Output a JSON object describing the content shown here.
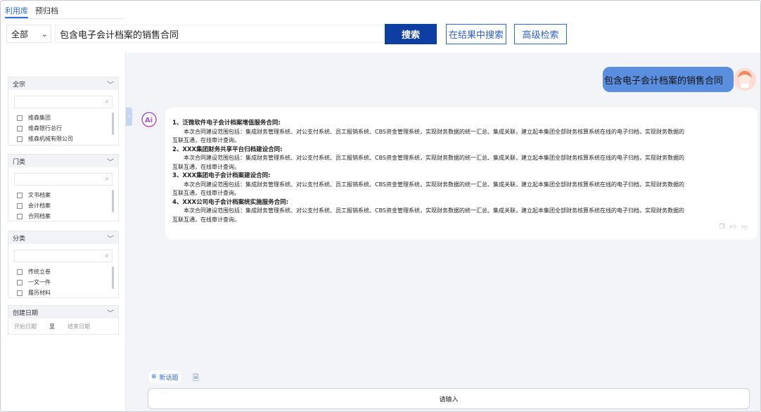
{
  "top_tabs": [
    {
      "label": "利用库",
      "active": true
    },
    {
      "label": "预归档",
      "active": false
    }
  ],
  "search": {
    "scope": "全部",
    "query": "包含电子会计档案的销售合同",
    "search_label": "搜索",
    "in_results_label": "在结果中搜索",
    "advanced_label": "高级检索"
  },
  "filters": {
    "fonds": {
      "title": "全宗",
      "items": [
        "维森集团",
        "维森银行总行",
        "维森机械有限公司"
      ]
    },
    "category_door": {
      "title": "门类",
      "items": [
        "文书档案",
        "会计档案",
        "合同档案"
      ]
    },
    "classification": {
      "title": "分类",
      "items": [
        "传统立卷",
        "一文一件",
        "履历材料"
      ]
    },
    "created_date": {
      "title": "创建日期",
      "start_placeholder": "开始日期",
      "separator": "至",
      "end_placeholder": "结束日期"
    }
  },
  "chat": {
    "user_message": "包含电子会计档案的销售合同",
    "ai_items": [
      {
        "title": "1、泛微软件电子会计档案增值服务合同:",
        "body_line1": "本次合同建设范围包括：集成财务管理系统、对公支付系统、员工报销系统、CBS资金管理系统，实现财务数据的统一汇总、集成关联，建立起本集团全部财务核算系统在线的电子归档，实现财务数据的",
        "body_line2": "互联互通，在线审计查询。"
      },
      {
        "title": "2、XXX集团财务共享平台归档建设合同:",
        "body_line1": "本次合同建设范围包括：集成财务管理系统、对公支付系统、员工报销系统、CBS资金管理系统，实现财务数据的统一汇总、集成关联，建立起本集团全部财务核算系统在线的电子归档，实现财务数据的",
        "body_line2": "互联互通，在线审计查询。"
      },
      {
        "title": "3、XXX集团电子会计档案建设合同:",
        "body_line1": "本次合同建设范围包括：集成财务管理系统、对公支付系统、员工报销系统、CBS资金管理系统，实现财务数据的统一汇总、集成关联，建立起本集团全部财务核算系统在线的电子归档，实现财务数据的",
        "body_line2": "互联互通，在线审计查询。"
      },
      {
        "title": "4、XXX公司电子会计档案统实施服务合同:",
        "body_line1": "本次合同建设范围包括：集成财务管理系统、对公支付系统、员工报销系统、CBS资金管理系统，实现财务数据的统一汇总、集成关联，建立起本集团全部财务核算系统在线的电子归档，实现财务数据的",
        "body_line2": "互联互通，在线审计查询。"
      }
    ],
    "new_topic_label": "新话题",
    "input_placeholder": "请输入"
  },
  "icons": {
    "copy": "copy-icon",
    "thumb_up": "thumb-up-icon",
    "thumb_down": "thumb-down-icon",
    "ai": "ai-logo-icon"
  },
  "colors": {
    "primary": "#0f3ea3",
    "accent": "#2f6bd8",
    "user_bubble": "#5a8fe0",
    "chat_bg": "#f3f4f8"
  }
}
